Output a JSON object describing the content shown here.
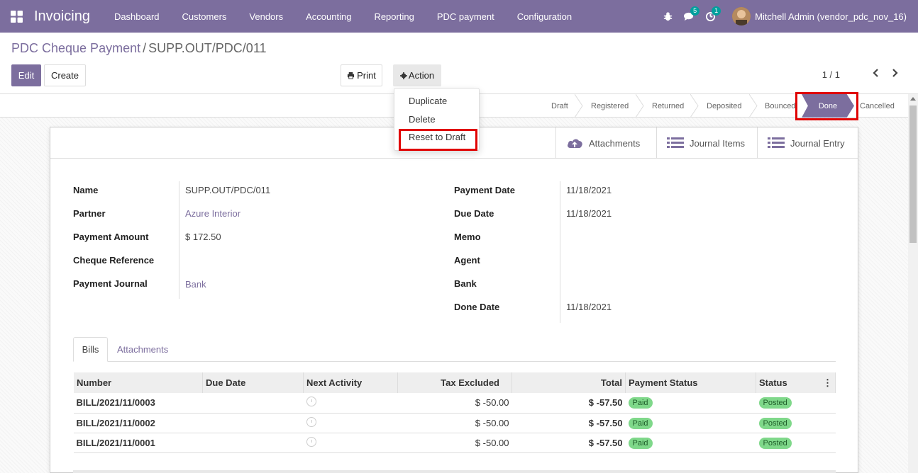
{
  "navbar": {
    "app_name": "Invoicing",
    "menu": [
      "Dashboard",
      "Customers",
      "Vendors",
      "Accounting",
      "Reporting",
      "PDC payment",
      "Configuration"
    ],
    "messages_count": "5",
    "activities_count": "1",
    "user": "Mitchell Admin (vendor_pdc_nov_16)"
  },
  "breadcrumb": {
    "parent": "PDC Cheque Payment",
    "separator": "/",
    "current": "SUPP.OUT/PDC/011"
  },
  "buttons": {
    "edit": "Edit",
    "create": "Create",
    "print": "Print",
    "action": "Action"
  },
  "pager": "1 / 1",
  "action_menu": [
    "Duplicate",
    "Delete",
    "Reset to Draft"
  ],
  "statusbar": {
    "stages": [
      "Draft",
      "Registered",
      "Returned",
      "Deposited",
      "Bounced",
      "Done",
      "Cancelled"
    ],
    "active": "Done"
  },
  "smart_buttons": [
    "Attachments",
    "Journal Items",
    "Journal Entry"
  ],
  "form": {
    "left": [
      {
        "label": "Name",
        "value": "SUPP.OUT/PDC/011"
      },
      {
        "label": "Partner",
        "value": "Azure Interior"
      },
      {
        "label": "Payment Amount",
        "value": "$ 172.50"
      },
      {
        "label": "Cheque Reference",
        "value": ""
      },
      {
        "label": "Payment Journal",
        "value": "Bank"
      }
    ],
    "right": [
      {
        "label": "Payment Date",
        "value": "11/18/2021"
      },
      {
        "label": "Due Date",
        "value": "11/18/2021"
      },
      {
        "label": "Memo",
        "value": ""
      },
      {
        "label": "Agent",
        "value": ""
      },
      {
        "label": "Bank",
        "value": ""
      },
      {
        "label": "Done Date",
        "value": "11/18/2021"
      }
    ]
  },
  "tabs": [
    "Bills",
    "Attachments"
  ],
  "bills_table": {
    "columns": [
      "Number",
      "Due Date",
      "Next Activity",
      "Tax Excluded",
      "Total",
      "Payment Status",
      "Status"
    ],
    "rows": [
      {
        "number": "BILL/2021/11/0003",
        "due_date": "",
        "tax_excluded": "$ -50.00",
        "total": "$ -57.50",
        "payment_status": "Paid",
        "status": "Posted"
      },
      {
        "number": "BILL/2021/11/0002",
        "due_date": "",
        "tax_excluded": "$ -50.00",
        "total": "$ -57.50",
        "payment_status": "Paid",
        "status": "Posted"
      },
      {
        "number": "BILL/2021/11/0001",
        "due_date": "",
        "tax_excluded": "$ -50.00",
        "total": "$ -57.50",
        "payment_status": "Paid",
        "status": "Posted"
      }
    ]
  },
  "colors": {
    "brand": "#7c6e9e",
    "highlight": "#e00000",
    "badge": "#00a09d",
    "pill": "#7fd88a"
  }
}
